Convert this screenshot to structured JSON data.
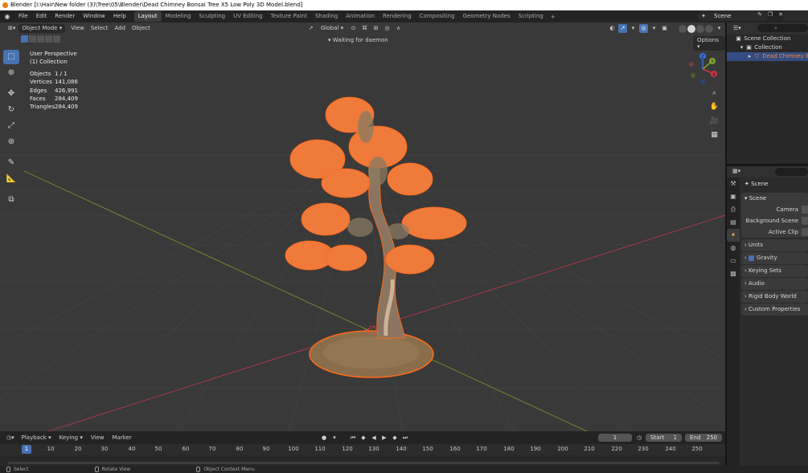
{
  "title_bar": "Blender [I:\\Hair\\New folder (3)\\Tree\\05\\Blender\\Dead Chimney Bonsai Tree X5 Low Poly 3D Model.blend]",
  "menu": [
    "File",
    "Edit",
    "Render",
    "Window",
    "Help"
  ],
  "workspaces": [
    {
      "label": "Layout",
      "active": true
    },
    {
      "label": "Modeling"
    },
    {
      "label": "Sculpting"
    },
    {
      "label": "UV Editing"
    },
    {
      "label": "Texture Paint"
    },
    {
      "label": "Shading"
    },
    {
      "label": "Animation"
    },
    {
      "label": "Rendering"
    },
    {
      "label": "Compositing"
    },
    {
      "label": "Geometry Nodes"
    },
    {
      "label": "Scripting"
    }
  ],
  "scene_name": "Scene",
  "viewport": {
    "mode": "Object Mode",
    "menus": [
      "View",
      "Select",
      "Add",
      "Object"
    ],
    "orientation": "Global",
    "options": "Options",
    "status": "Waiting for daemon",
    "perspective": "User Perspective",
    "collection": "(1) Collection",
    "stats": [
      {
        "k": "Objects",
        "v": "1 / 1"
      },
      {
        "k": "Vertices",
        "v": "141,086"
      },
      {
        "k": "Edges",
        "v": "426,991"
      },
      {
        "k": "Faces",
        "v": "284,409"
      },
      {
        "k": "Triangles",
        "v": "284,409"
      }
    ],
    "gizmo": {
      "x": "X",
      "y": "Y",
      "z": "Z"
    }
  },
  "timeline": {
    "menus": [
      "Playback",
      "Keying",
      "View",
      "Marker"
    ],
    "current_frame": "1",
    "start_label": "Start",
    "start": "1",
    "end_label": "End",
    "end": "250",
    "ticks": [
      "10",
      "20",
      "30",
      "40",
      "50",
      "60",
      "70",
      "80",
      "90",
      "100",
      "110",
      "120",
      "130",
      "140",
      "150",
      "160",
      "170",
      "180",
      "190",
      "200",
      "210",
      "220",
      "230",
      "240",
      "250"
    ]
  },
  "status_bar": [
    "Select",
    "Rotate View",
    "Object Context Menu"
  ],
  "outliner": {
    "root": "Scene Collection",
    "collection": "Collection",
    "object": "Dead Chimney Bonsai"
  },
  "properties": {
    "crumb": "Scene",
    "panel_title": "Scene",
    "rows": [
      "Camera",
      "Background Scene",
      "Active Clip"
    ],
    "collapsed": [
      {
        "label": "Units"
      },
      {
        "label": "Gravity",
        "checkbox": true
      },
      {
        "label": "Keying Sets"
      },
      {
        "label": "Audio"
      },
      {
        "label": "Rigid Body World"
      },
      {
        "label": "Custom Properties"
      }
    ]
  },
  "colors": {
    "selection_outline": "#ff6a1a",
    "accent": "#4772b3",
    "x_axis": "#c8384a",
    "y_axis": "#7ea32b",
    "z_axis": "#3b6fd9"
  }
}
